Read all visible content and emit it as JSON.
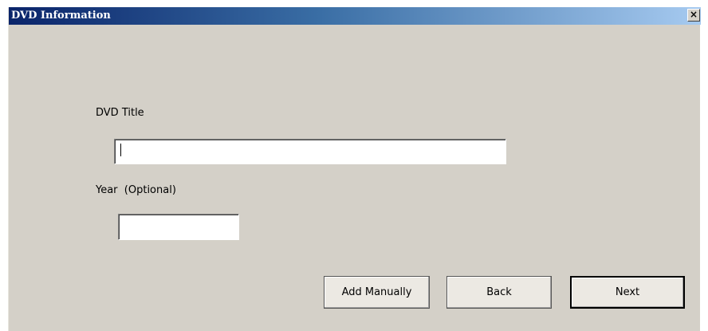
{
  "window": {
    "title": "DVD Information",
    "close_symbol": "×"
  },
  "form": {
    "dvd_title_label": "DVD Title",
    "dvd_title_value": "",
    "year_label": "Year  (Optional)",
    "year_value": ""
  },
  "buttons": {
    "add_manually": "Add Manually",
    "back": "Back",
    "next": "Next"
  },
  "icons": {
    "close": "close-icon"
  },
  "colors": {
    "titlebar_start": "#0a246a",
    "titlebar_end": "#a6caf0",
    "dialog_bg": "#d4d0c8"
  }
}
